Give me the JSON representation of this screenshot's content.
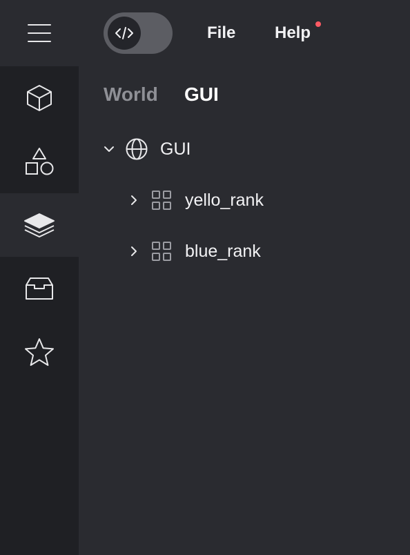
{
  "header": {
    "menu": [
      {
        "label": "File"
      },
      {
        "label": "Help"
      }
    ],
    "help_has_notification": true,
    "notification_color": "#ff5a64"
  },
  "sidebar": {
    "menu_icon": "hamburger-icon",
    "items": [
      {
        "icon": "cube-icon",
        "active": false
      },
      {
        "icon": "shapes-icon",
        "active": false
      },
      {
        "icon": "layers-icon",
        "active": true
      },
      {
        "icon": "inbox-icon",
        "active": false
      },
      {
        "icon": "star-icon",
        "active": false
      }
    ]
  },
  "tabs": [
    {
      "label": "World",
      "active": false
    },
    {
      "label": "GUI",
      "active": true
    }
  ],
  "tree": {
    "root": {
      "label": "GUI",
      "icon": "globe-icon",
      "expanded": true
    },
    "children": [
      {
        "label": "yello_rank",
        "icon": "grid-icon",
        "expanded": false
      },
      {
        "label": "blue_rank",
        "icon": "grid-icon",
        "expanded": false
      }
    ]
  },
  "colors": {
    "background": "#2a2b30",
    "sidebar": "#1f2024",
    "toggle": "#5c5d63",
    "text": "#f2f2f4",
    "muted_text": "#8f9096"
  }
}
